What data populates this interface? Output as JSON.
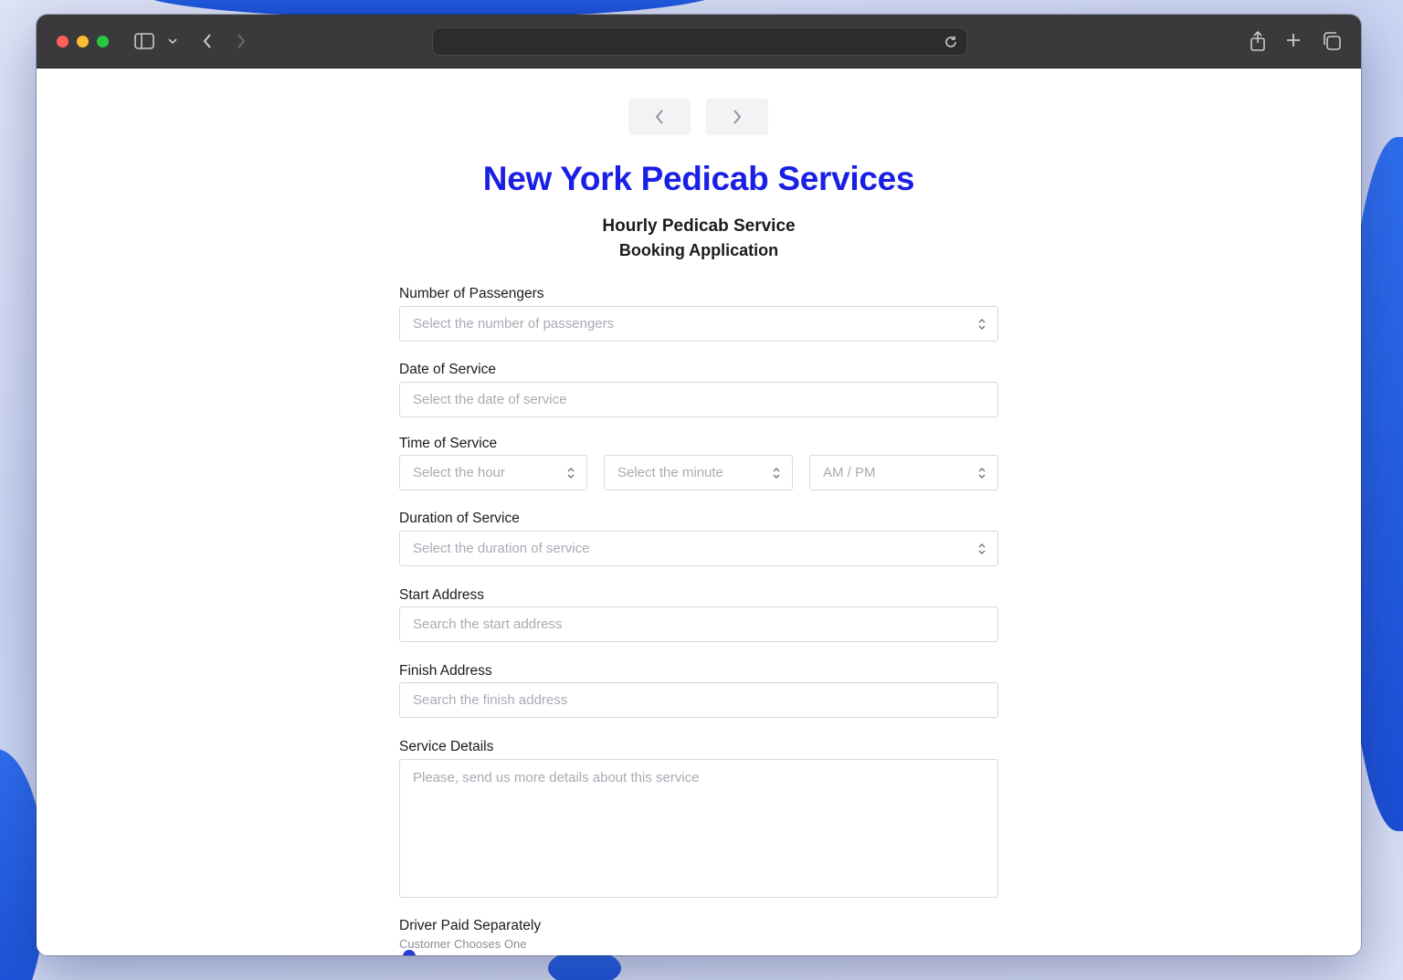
{
  "browser": {
    "back_icon": "chevron-left-icon",
    "forward_icon": "chevron-right-icon",
    "sidebar_icon": "sidebar-icon",
    "reload_icon": "reload-icon",
    "share_icon": "share-icon",
    "new_tab_icon": "plus-icon",
    "tabs_icon": "tabs-overview-icon"
  },
  "header": {
    "title": "New York Pedicab Services",
    "subtitle_1": "Hourly Pedicab Service",
    "subtitle_2": "Booking Application",
    "title_color": "#1a1fe6"
  },
  "form": {
    "passengers": {
      "label": "Number of Passengers",
      "placeholder": "Select the number of passengers"
    },
    "date": {
      "label": "Date of Service",
      "placeholder": "Select the date of service"
    },
    "time": {
      "label": "Time of Service",
      "hour_placeholder": "Select the hour",
      "minute_placeholder": "Select the minute",
      "ampm_placeholder": "AM / PM"
    },
    "duration": {
      "label": "Duration of Service",
      "placeholder": "Select the duration of service"
    },
    "start": {
      "label": "Start Address",
      "placeholder": "Search the start address"
    },
    "finish": {
      "label": "Finish Address",
      "placeholder": "Search the finish address"
    },
    "details": {
      "label": "Service Details",
      "placeholder": "Please, send us more details about this service"
    },
    "driver": {
      "label": "Driver Paid Separately",
      "hint": "Customer Chooses One"
    }
  }
}
